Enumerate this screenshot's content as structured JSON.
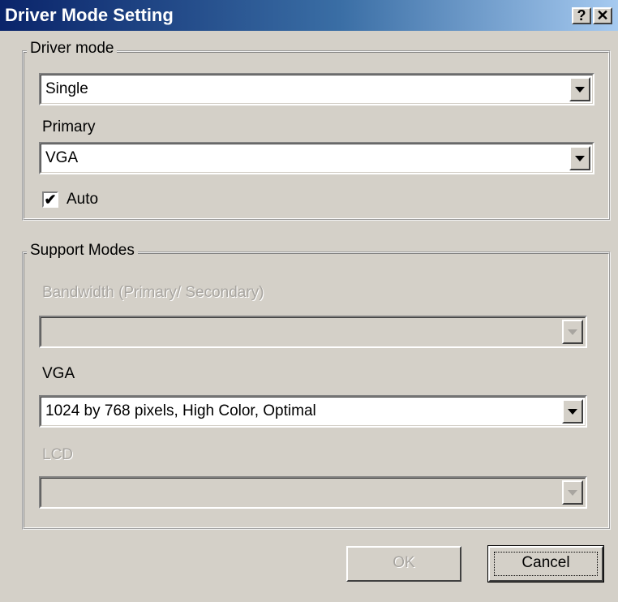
{
  "window": {
    "title": "Driver Mode Setting",
    "help_icon": "?",
    "close_icon": "✕"
  },
  "driver_mode": {
    "legend": "Driver mode",
    "mode_value": "Single",
    "primary_label": "Primary",
    "primary_value": "VGA",
    "auto_label": "Auto",
    "auto_checked": true,
    "check_mark": "✔"
  },
  "support_modes": {
    "legend": "Support Modes",
    "bandwidth_label": "Bandwidth (Primary/ Secondary)",
    "bandwidth_value": "",
    "vga_label": "VGA",
    "vga_value": "1024 by 768 pixels, High Color, Optimal",
    "lcd_label": "LCD",
    "lcd_value": ""
  },
  "buttons": {
    "ok_label": "OK",
    "cancel_label": "Cancel"
  },
  "colors": {
    "title_gradient_start": "#0a246a",
    "title_gradient_end": "#a6caf0",
    "face": "#d4d0c8",
    "disabled_text": "#a8a5a0"
  }
}
